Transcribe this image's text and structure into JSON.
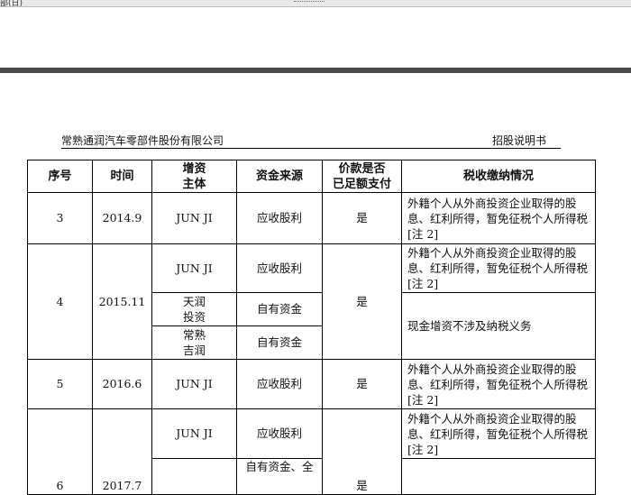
{
  "topbar": {
    "text": "部(日)"
  },
  "header": {
    "company": "常熟通润汽车零部件股份有限公司",
    "doc": "招股说明书"
  },
  "table": {
    "headers": [
      "序号",
      "时间",
      "增资\n主体",
      "资金来源",
      "价款是否\n已足额支付",
      "税收缴纳情况"
    ],
    "row3": {
      "no": "3",
      "time": "2014.9",
      "subject": "JUN JI",
      "source": "应收股利",
      "paid": "是",
      "tax": "外籍个人从外商投资企业取得的股息、红利所得，暂免征税个人所得税[注 2]"
    },
    "row4": {
      "no": "4",
      "time": "2015.11",
      "paid": "是",
      "sub1": "JUN JI",
      "src1": "应收股利",
      "tax1": "外籍个人从外商投资企业取得的股息、红利所得，暂免征税个人所得税[注 2]",
      "sub2": "天润\n投资",
      "src2": "自有资金",
      "sub3": "常熟\n吉润",
      "src3": "自有资金",
      "tax2": "现金增资不涉及纳税义务"
    },
    "row5": {
      "no": "5",
      "time": "2016.6",
      "subject": "JUN JI",
      "source": "应收股利",
      "paid": "是",
      "tax": "外籍个人从外商投资企业取得的股息、红利所得，暂免征税个人所得税[注 2]"
    },
    "row6": {
      "no": "6",
      "time": "2017.7",
      "sub1": "JUN JI",
      "src1": "应收股利",
      "paid": "是",
      "tax1": "外籍个人从外商投资企业取得的股息、红利所得，暂免征税个人所得税[注 2]",
      "src2": "自有资金、全"
    }
  }
}
